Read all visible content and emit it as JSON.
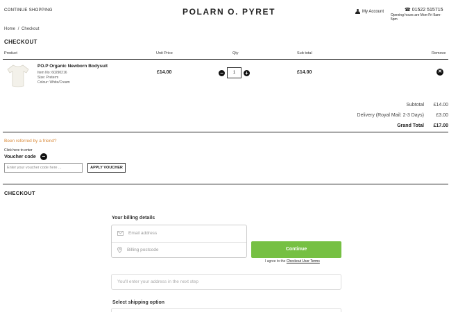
{
  "header": {
    "continue_shopping": "CONTINUE SHOPPING",
    "logo": "POLARN O. PYRET",
    "account": "My Account",
    "phone": "01522 515715",
    "hours": "Opening hours are Mon-Fri 9am-5pm"
  },
  "breadcrumb": {
    "home": "Home",
    "sep": "/",
    "current": "Checkout"
  },
  "page_title": "CHECKOUT",
  "table": {
    "headers": {
      "product": "Product",
      "unit_price": "Unit Price",
      "qty": "Qty",
      "subtotal": "Sub total",
      "remove": "Remove"
    },
    "item": {
      "name": "PO.P Organic Newborn Bodysuit",
      "item_no": "Item No: 60290216",
      "size": "Size: Preterm",
      "colour": "Colour: White/Cream",
      "unit_price": "£14.00",
      "qty": "1",
      "subtotal": "£14.00"
    }
  },
  "totals": {
    "subtotal_label": "Subtotal",
    "subtotal_value": "£14.00",
    "delivery_label": "Delivery (Royal Mail: 2-3 Days)",
    "delivery_value": "£3.00",
    "grand_label": "Grand Total",
    "grand_value": "£17.00"
  },
  "referral": "Been referred by a friend?",
  "voucher": {
    "hint": "Click here to enter",
    "title": "Voucher code",
    "placeholder": "Enter your voucher code here ...",
    "button": "APPLY VOUCHER"
  },
  "checkout2_title": "CHECKOUT",
  "billing": {
    "title": "Your billing details",
    "email_placeholder": "Email address",
    "postcode_placeholder": "Billing postcode",
    "continue": "Continue",
    "agree_prefix": "I agree to the",
    "agree_link": "Checkout User Terms",
    "address_note": "You'll enter your address in the next step"
  },
  "shipping": {
    "title": "Select shipping option"
  },
  "colors": {
    "accent_green": "#76c043",
    "referral_orange": "#d98a3a"
  },
  "icons": {
    "account": "user-icon",
    "phone": "phone-icon",
    "minus": "minus-icon",
    "plus": "plus-icon",
    "remove": "remove-icon",
    "email": "mail-icon",
    "location": "location-pin-icon"
  }
}
